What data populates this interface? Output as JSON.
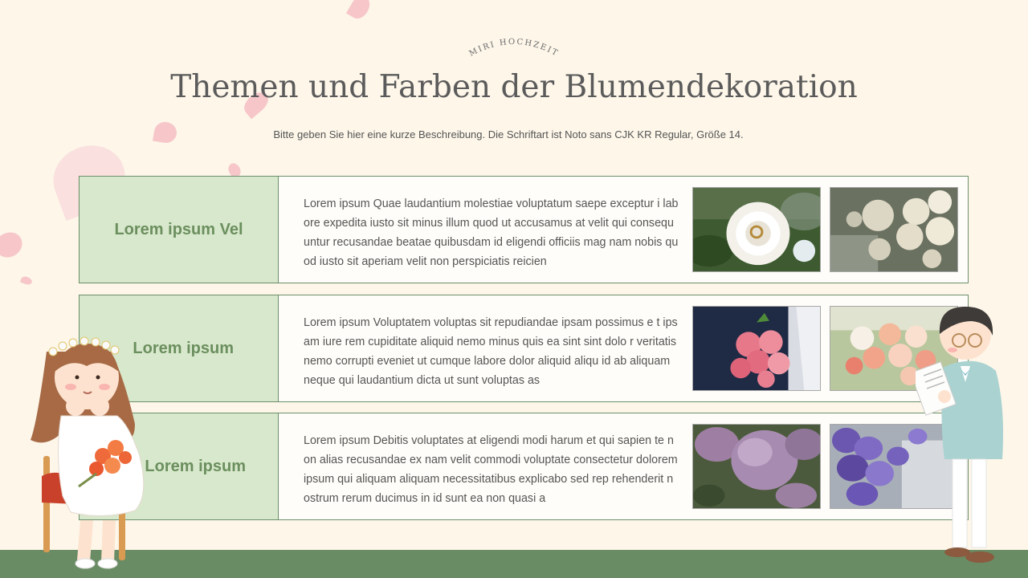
{
  "brand": "MIRI HOCHZEIT",
  "title": "Themen und Farben der Blumendekoration",
  "subtitle": "Bitte geben Sie hier eine kurze Beschreibung. Die Schriftart ist Noto sans CJK KR Regular, Größe 14.",
  "rows": [
    {
      "label": "Lorem ipsum Vel",
      "text": "Lorem ipsum Quae laudantium molestiae voluptatum saepe exceptur i labore expedita iusto sit minus illum quod ut accusamus at velit qui consequuntur recusandae beatae quibusdam id eligendi officiis mag nam nobis quod iusto sit aperiam velit non perspiciatis reicien",
      "images": [
        "white-rose-ring-photo",
        "white-rose-bouquet-photo"
      ]
    },
    {
      "label": "Lorem ipsum",
      "text": "Lorem ipsum Voluptatem voluptas sit repudiandae ipsam possimus e t ipsam iure rem cupiditate aliquid nemo minus quis ea sint sint dolo r veritatis nemo corrupti eveniet ut cumque labore dolor aliquid aliqu id ab aliquam neque qui laudantium dicta ut sunt voluptas as",
      "images": [
        "pink-rose-bouquet-photo",
        "peach-bouquet-photo"
      ]
    },
    {
      "label": "Lorem ipsum",
      "text": "Lorem ipsum Debitis voluptates at eligendi modi harum et qui sapien te non alias recusandae ex nam velit commodi voluptate consectetur dolorem ipsum qui aliquam aliquam necessitatibus explicabo sed rep rehenderit nostrum rerum ducimus in id sunt ea non quasi a",
      "images": [
        "lilac-flowers-photo",
        "purple-tulips-photo"
      ]
    }
  ],
  "colors": {
    "background": "#fdf6e9",
    "accent_green": "#6a8c64",
    "label_fill": "#d8e8cc",
    "petal_pink": "#f4b5bd"
  }
}
